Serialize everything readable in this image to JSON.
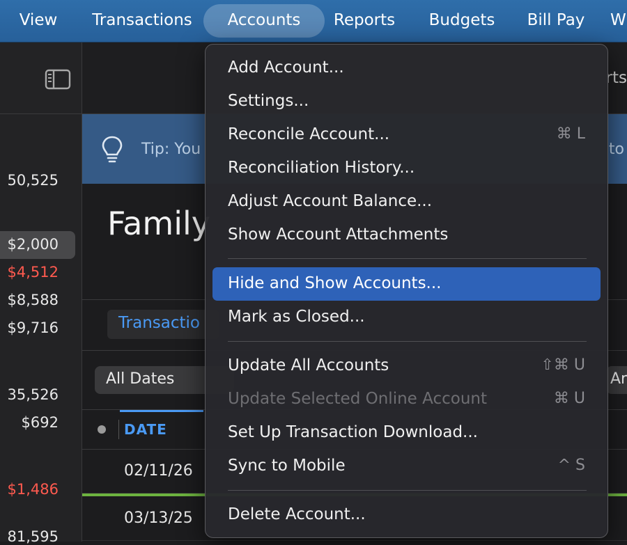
{
  "menubar": {
    "items": [
      {
        "label": "View"
      },
      {
        "label": "Transactions"
      },
      {
        "label": "Accounts"
      },
      {
        "label": "Reports"
      },
      {
        "label": "Budgets"
      },
      {
        "label": "Bill Pay"
      },
      {
        "label": "W"
      }
    ],
    "active_index": 2
  },
  "sidebar": {
    "values": [
      {
        "text": "50,525",
        "negative": false
      },
      {
        "text": "$2,000",
        "negative": false,
        "selected": true
      },
      {
        "text": "$4,512",
        "negative": true
      },
      {
        "text": "$8,588",
        "negative": false
      },
      {
        "text": "$9,716",
        "negative": false
      },
      {
        "text": "35,526",
        "negative": false
      },
      {
        "text": "$692",
        "negative": false
      },
      {
        "text": "$1,486",
        "negative": true
      },
      {
        "text": "81,595",
        "negative": false
      }
    ]
  },
  "toolbar": {
    "right_text": "rts"
  },
  "tip": {
    "text": "Tip: You",
    "text_right": "to"
  },
  "account": {
    "title": "Family"
  },
  "tabs": {
    "transactions": "Transactio"
  },
  "filters": {
    "date": "All Dates",
    "right": "Ar"
  },
  "columns": {
    "date": "DATE"
  },
  "transactions": [
    {
      "date": "02/11/26"
    },
    {
      "date": "03/13/25"
    }
  ],
  "accounts_menu": {
    "items": [
      {
        "label": "Add Account...",
        "shortcut": ""
      },
      {
        "label": "Settings...",
        "shortcut": ""
      },
      {
        "label": "Reconcile Account...",
        "shortcut": "⌘ L"
      },
      {
        "label": "Reconciliation History...",
        "shortcut": ""
      },
      {
        "label": "Adjust Account Balance...",
        "shortcut": ""
      },
      {
        "label": "Show Account Attachments",
        "shortcut": ""
      },
      {
        "label": "Hide and Show Accounts...",
        "shortcut": "",
        "highlighted": true
      },
      {
        "label": "Mark as Closed...",
        "shortcut": ""
      },
      {
        "label": "Update All Accounts",
        "shortcut": "⇧⌘ U"
      },
      {
        "label": "Update Selected Online Account",
        "shortcut": "⌘ U",
        "disabled": true
      },
      {
        "label": "Set Up Transaction Download...",
        "shortcut": ""
      },
      {
        "label": "Sync to Mobile",
        "shortcut": "^ S"
      },
      {
        "label": "Delete Account...",
        "shortcut": ""
      }
    ]
  },
  "colors": {
    "menubar": "#2f6eaa",
    "highlight": "#2e62b8",
    "accent_blue": "#4a9af5",
    "negative_red": "#ff5a4f",
    "positive_green": "#6db33f"
  }
}
